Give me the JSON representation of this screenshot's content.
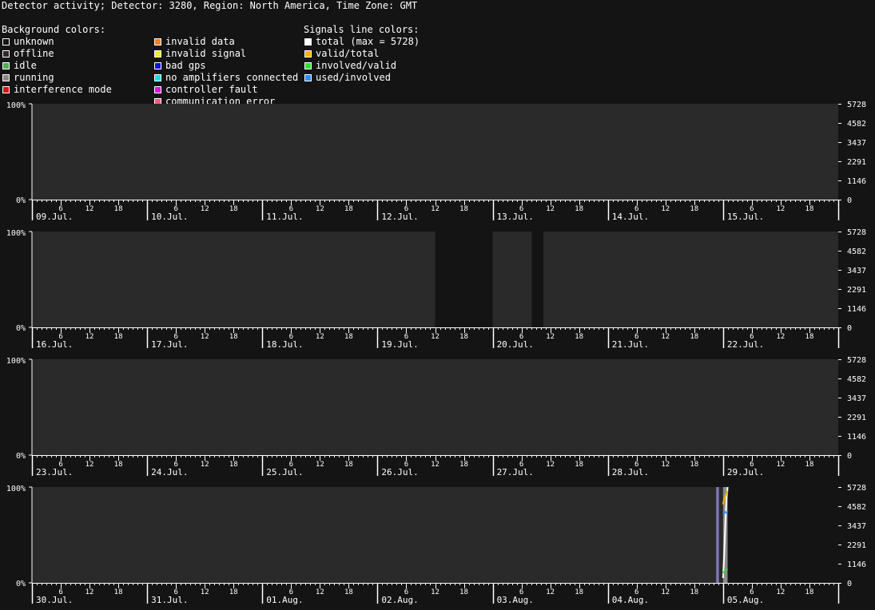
{
  "title": "Detector activity; Detector: 3280, Region: North America, Time Zone: GMT",
  "legend": {
    "background": {
      "heading": "Background colors:",
      "items": [
        {
          "label": "unknown",
          "color": "#111111"
        },
        {
          "label": "offline",
          "color": "#2b2b2b"
        },
        {
          "label": "idle",
          "color": "#4caf50"
        },
        {
          "label": "running",
          "color": "#888888"
        },
        {
          "label": "interference mode",
          "color": "#e01010"
        },
        {
          "label": "invalid data",
          "color": "#f08020"
        },
        {
          "label": "invalid signal",
          "color": "#f0f020"
        },
        {
          "label": "bad gps",
          "color": "#1010e0"
        },
        {
          "label": "no amplifiers connected",
          "color": "#10e0e0"
        },
        {
          "label": "controller fault",
          "color": "#e010e0"
        },
        {
          "label": "communication error",
          "color": "#f06080"
        }
      ]
    },
    "signals": {
      "heading": "Signals line colors:",
      "items": [
        {
          "label": "total (max = 5728)",
          "color": "#ffffff"
        },
        {
          "label": "valid/total",
          "color": "#ffb000"
        },
        {
          "label": "involved/valid",
          "color": "#30e030"
        },
        {
          "label": "used/involved",
          "color": "#3090ff"
        }
      ]
    }
  },
  "chart_data": {
    "type": "area",
    "rows": [
      {
        "days": [
          "09.Jul.",
          "10.Jul.",
          "11.Jul.",
          "12.Jul.",
          "13.Jul.",
          "14.Jul.",
          "15.Jul."
        ],
        "segments": [
          {
            "start": 0,
            "end": 7,
            "state": "offline"
          }
        ]
      },
      {
        "days": [
          "16.Jul.",
          "17.Jul.",
          "18.Jul.",
          "19.Jul.",
          "20.Jul.",
          "21.Jul.",
          "22.Jul."
        ],
        "segments": [
          {
            "start": 0,
            "end": 3.5,
            "state": "offline"
          },
          {
            "start": 3.5,
            "end": 4.0,
            "state": "unknown"
          },
          {
            "start": 4.0,
            "end": 4.34,
            "state": "offline"
          },
          {
            "start": 4.34,
            "end": 4.44,
            "state": "unknown"
          },
          {
            "start": 4.44,
            "end": 7,
            "state": "offline"
          }
        ],
        "stripes": [
          3.5,
          3.54,
          4.36,
          4.4
        ]
      },
      {
        "days": [
          "23.Jul.",
          "24.Jul.",
          "25.Jul.",
          "26.Jul.",
          "27.Jul.",
          "28.Jul.",
          "29.Jul."
        ],
        "segments": [
          {
            "start": 0,
            "end": 7,
            "state": "offline"
          }
        ]
      },
      {
        "days": [
          "30.Jul.",
          "31.Jul.",
          "01.Aug.",
          "02.Aug.",
          "03.Aug.",
          "04.Aug.",
          "05.Aug."
        ],
        "segments": [
          {
            "start": 0,
            "end": 5.94,
            "state": "offline"
          },
          {
            "start": 5.94,
            "end": 5.965,
            "state": "bad_gps_band"
          },
          {
            "start": 5.965,
            "end": 6.0,
            "state": "offline"
          },
          {
            "start": 6.0,
            "end": 6.04,
            "state": "running"
          },
          {
            "start": 6.04,
            "end": 7,
            "state": "unknown"
          }
        ],
        "signals": {
          "total": [
            [
              6.0,
              0.05
            ],
            [
              6.01,
              0.3
            ],
            [
              6.02,
              0.62
            ],
            [
              6.03,
              0.88
            ],
            [
              6.04,
              1.0
            ]
          ],
          "valid_total": [
            [
              6.0,
              0.82
            ],
            [
              6.01,
              0.88
            ],
            [
              6.02,
              0.9
            ],
            [
              6.03,
              0.93
            ],
            [
              6.04,
              0.96
            ]
          ],
          "involved_valid": [
            [
              6.0,
              0.1
            ],
            [
              6.01,
              0.12
            ],
            [
              6.02,
              0.13
            ],
            [
              6.03,
              0.14
            ],
            [
              6.04,
              0.14
            ]
          ],
          "used_involved": [
            [
              6.0,
              0.72
            ],
            [
              6.01,
              0.73
            ],
            [
              6.02,
              0.74
            ],
            [
              6.03,
              0.73
            ],
            [
              6.04,
              0.75
            ]
          ]
        }
      }
    ],
    "hour_ticks": [
      "6",
      "12",
      "18"
    ],
    "y_left_labels": [
      "100%",
      "0%"
    ],
    "y_right_labels": [
      "5728",
      "4582",
      "3437",
      "2291",
      "1146",
      "0"
    ],
    "colors": {
      "offline": "#2a2a2a",
      "unknown": "#141414",
      "running": "#8a8a8a",
      "bad_gps_band": "#7a7ab8",
      "axis": "#ffffff",
      "tick_text": "#ffffff"
    }
  }
}
